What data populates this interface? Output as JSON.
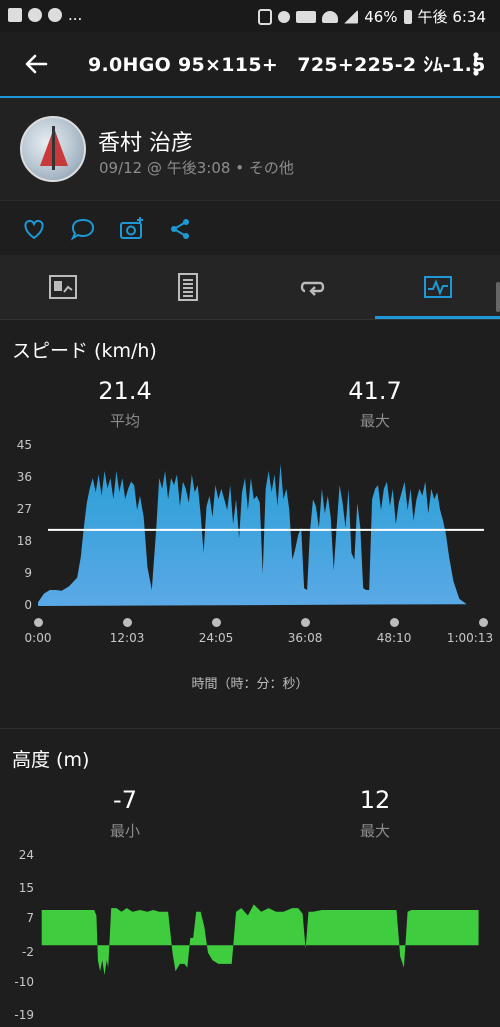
{
  "status_bar": {
    "left_ellipsis": "...",
    "battery": "46%",
    "time": "午後 6:34"
  },
  "app_bar": {
    "title": "9.0HGO 95×115+　725+225-2 ｼﾑ-1.5"
  },
  "profile": {
    "name": "香村 治彦",
    "meta": "09/12 @ 午後3:08 • その他"
  },
  "actions": [
    "heart-icon",
    "comment-icon",
    "camera-add-icon",
    "share-icon"
  ],
  "tabs": [
    {
      "icon": "summary-icon",
      "active": false
    },
    {
      "icon": "details-icon",
      "active": false
    },
    {
      "icon": "laps-icon",
      "active": false
    },
    {
      "icon": "charts-icon",
      "active": true
    }
  ],
  "colors": {
    "accent": "#1d9ad6",
    "speed_fill": "#2a9fd6",
    "elevation_fill": "#3fcc3f"
  },
  "speed": {
    "title": "スピード (km/h)",
    "avg_value": "21.4",
    "avg_label": "平均",
    "max_value": "41.7",
    "max_label": "最大",
    "x_axis_title": "時間（時：分：秒）"
  },
  "elevation": {
    "title": "高度 (m)",
    "min_value": "-7",
    "min_label": "最小",
    "max_value": "12",
    "max_label": "最大"
  },
  "chart_data": [
    {
      "type": "area",
      "title": "スピード (km/h)",
      "xlabel": "時間（時：分：秒）",
      "ylabel": "",
      "y_ticks": [
        "0",
        "9",
        "18",
        "27",
        "36",
        "45"
      ],
      "x_ticks": [
        "0:00",
        "12:03",
        "24:05",
        "36:08",
        "48:10",
        "1:00:13"
      ],
      "ylim": [
        0,
        45
      ],
      "xlim_minutes": [
        0,
        60.2
      ],
      "average_line": 21.4,
      "x_minutes": [
        0,
        0.8,
        1.6,
        2.4,
        3.2,
        4.2,
        5.3,
        5.8,
        6.2,
        6.6,
        7.0,
        7.4,
        7.8,
        8.2,
        8.6,
        9.0,
        9.4,
        9.8,
        10.2,
        10.6,
        11.0,
        11.4,
        11.8,
        12.2,
        12.6,
        13.0,
        13.4,
        13.8,
        14.3,
        14.8,
        15.4,
        16.0,
        16.4,
        16.8,
        17.2,
        17.6,
        18.0,
        18.4,
        18.8,
        19.2,
        19.6,
        20.0,
        20.4,
        20.8,
        21.2,
        21.6,
        22.0,
        22.4,
        22.8,
        23.2,
        23.6,
        24.0,
        24.4,
        24.8,
        25.2,
        25.6,
        26.0,
        26.4,
        26.8,
        27.2,
        27.6,
        28.0,
        28.4,
        28.8,
        29.2,
        29.6,
        30.0,
        30.4,
        30.8,
        31.2,
        31.6,
        32.0,
        32.4,
        32.8,
        33.2,
        33.6,
        34.0,
        34.4,
        34.8,
        35.2,
        35.6,
        36.0,
        36.4,
        36.8,
        37.2,
        37.6,
        38.0,
        38.4,
        38.8,
        39.2,
        39.6,
        40.0,
        40.4,
        40.8,
        41.2,
        41.6,
        42.0,
        42.4,
        42.8,
        43.2,
        43.6,
        44.0,
        44.4,
        44.8,
        45.2,
        45.6,
        46.0,
        46.4,
        46.8,
        47.2,
        47.6,
        48.0,
        48.4,
        48.8,
        49.2,
        49.6,
        50.0,
        50.4,
        50.8,
        51.2,
        51.6,
        52.0,
        52.4,
        52.8,
        53.2,
        53.6,
        54.0,
        54.4,
        54.8,
        55.2,
        55.6,
        56.2,
        57.0,
        58.0,
        58.8,
        59.6
      ],
      "values": [
        1,
        3.5,
        4.5,
        4.5,
        4.3,
        5.5,
        8,
        14,
        22,
        29,
        33,
        36,
        32,
        37,
        31,
        38,
        33,
        36,
        30,
        38,
        32,
        36,
        30,
        33,
        35,
        34,
        27,
        31,
        25,
        11,
        4.5,
        22,
        36,
        33,
        38,
        30,
        36,
        34,
        37,
        28,
        35,
        33,
        29,
        37,
        32,
        34,
        26,
        15,
        28,
        31,
        25,
        34,
        30,
        33,
        30,
        27,
        34,
        23,
        30,
        19,
        32,
        36,
        27,
        36,
        30,
        31,
        29,
        9,
        33,
        38,
        32,
        37,
        28,
        40,
        30,
        33,
        27,
        13,
        16,
        20,
        22,
        5,
        4.5,
        21,
        30,
        28,
        22,
        33,
        26,
        31,
        25,
        10,
        22,
        34,
        29,
        22,
        33,
        15,
        13,
        29,
        22,
        5,
        4.5,
        4.5,
        30,
        33,
        34,
        27,
        33,
        35,
        28,
        33,
        23,
        29,
        32,
        35,
        27,
        33,
        24,
        30,
        33,
        31,
        35,
        26,
        33,
        30,
        32,
        27,
        24,
        20,
        14,
        7,
        2,
        0.5
      ]
    },
    {
      "type": "area",
      "title": "高度 (m)",
      "xlabel": "",
      "ylabel": "",
      "y_ticks": [
        "-19",
        "-10",
        "-2",
        "7",
        "15",
        "24"
      ],
      "ylim": [
        -19,
        24
      ],
      "xlim_minutes": [
        0,
        60.2
      ],
      "x_minutes": [
        0.5,
        7.6,
        7.9,
        8.1,
        8.4,
        8.7,
        9.0,
        9.3,
        9.5,
        9.9,
        10.6,
        11.3,
        12.0,
        12.8,
        13.8,
        14.8,
        15.6,
        16.4,
        17.6,
        18.2,
        18.6,
        19.2,
        19.8,
        20.2,
        20.6,
        21.0,
        21.4,
        22.0,
        22.5,
        23.0,
        23.6,
        24.4,
        25.4,
        25.8,
        26.2,
        26.8,
        27.5,
        28.4,
        29.2,
        30.2,
        31.2,
        32.2,
        33.2,
        34.4,
        35.2,
        35.8,
        36.2,
        36.6,
        37.2,
        38.4,
        40.0,
        42.0,
        44.0,
        45.8,
        47.5,
        48.5,
        49.0,
        49.5,
        50.0,
        50.5,
        51.5,
        53.0,
        54.5,
        56.0,
        57.5,
        59.0,
        59.6
      ],
      "values": [
        9.5,
        9.5,
        8,
        -4,
        -7,
        -4,
        -8,
        -4,
        -6,
        10,
        10,
        9,
        10,
        9,
        9.5,
        9,
        9.5,
        9,
        9,
        -2,
        -7,
        -5,
        -5,
        -6,
        2,
        2,
        9,
        9,
        5,
        -2,
        -4,
        -5,
        -5,
        -5,
        -5,
        9,
        10,
        8,
        11,
        9,
        10,
        9,
        9,
        10,
        10,
        8.5,
        -1,
        9,
        9,
        9.5,
        9.5,
        9.5,
        9.5,
        9.5,
        9.5,
        9.5,
        -3,
        -6,
        9,
        9.5,
        9.5,
        9.5,
        9.5,
        9.5,
        9.5,
        9.5,
        9.5
      ]
    }
  ]
}
